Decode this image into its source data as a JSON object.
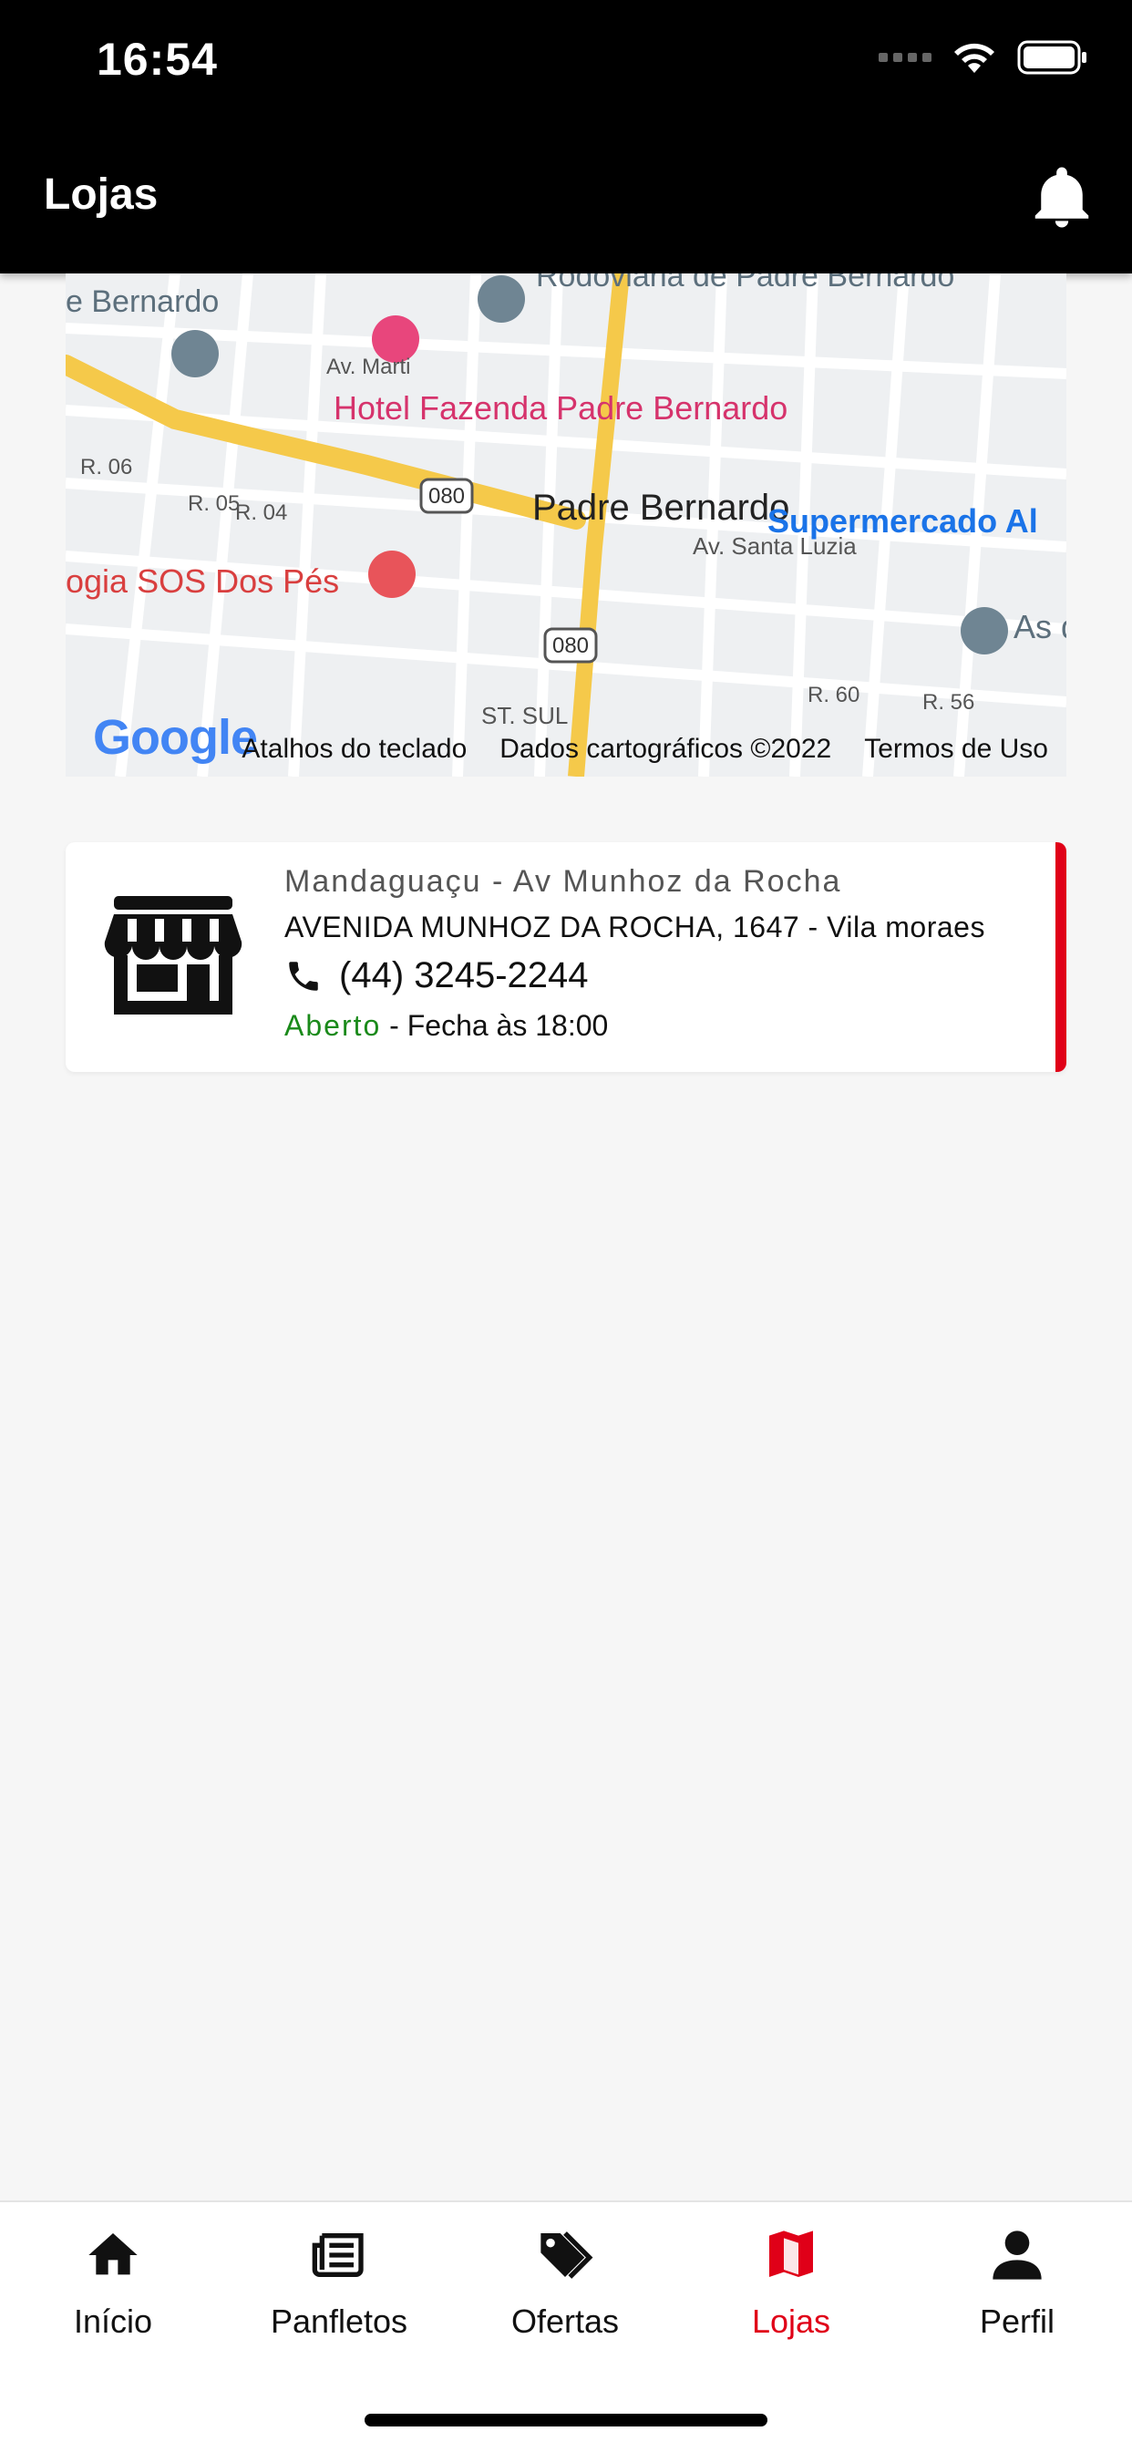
{
  "status_bar": {
    "time": "16:54"
  },
  "app_bar": {
    "title": "Lojas"
  },
  "map": {
    "labels": {
      "bus_station": "Rodoviária de Padre Bernardo",
      "hotel": "Hotel Fazenda Padre Bernardo",
      "city": "Padre Bernardo",
      "supermarket": "Supermercado Al",
      "podology": "ogia SOS Dos Pés",
      "left_place": "e Bernardo",
      "right_place": "As do",
      "street_santa_luzia": "Av. Santa Luzia",
      "street_sul": "ST. SUL",
      "street_r06": "R. 06",
      "street_r05": "R. 05",
      "street_r04": "R. 04",
      "street_r60": "R. 60",
      "street_r56": "R. 56",
      "street_martins": "Av. Marti",
      "route_080": "080"
    },
    "footer": {
      "brand": "Google",
      "shortcuts": "Atalhos do teclado",
      "map_data": "Dados cartográficos ©2022",
      "terms": "Termos de Uso"
    }
  },
  "store": {
    "name": "Mandaguaçu - Av Munhoz da Rocha",
    "address": "AVENIDA MUNHOZ DA ROCHA, 1647 - Vila moraes",
    "phone": "(44) 3245-2244",
    "status_open": "Aberto",
    "status_close": "- Fecha às 18:00"
  },
  "bottom_nav": {
    "items": [
      {
        "label": "Início",
        "icon": "home-icon"
      },
      {
        "label": "Panfletos",
        "icon": "newspaper-icon"
      },
      {
        "label": "Ofertas",
        "icon": "tags-icon"
      },
      {
        "label": "Lojas",
        "icon": "map-icon"
      },
      {
        "label": "Perfil",
        "icon": "person-icon"
      }
    ],
    "active_index": 3
  },
  "colors": {
    "accent": "#e00018",
    "open_green": "#1a8a1a",
    "header_bg": "#000000",
    "page_bg": "#f6f6f6"
  }
}
